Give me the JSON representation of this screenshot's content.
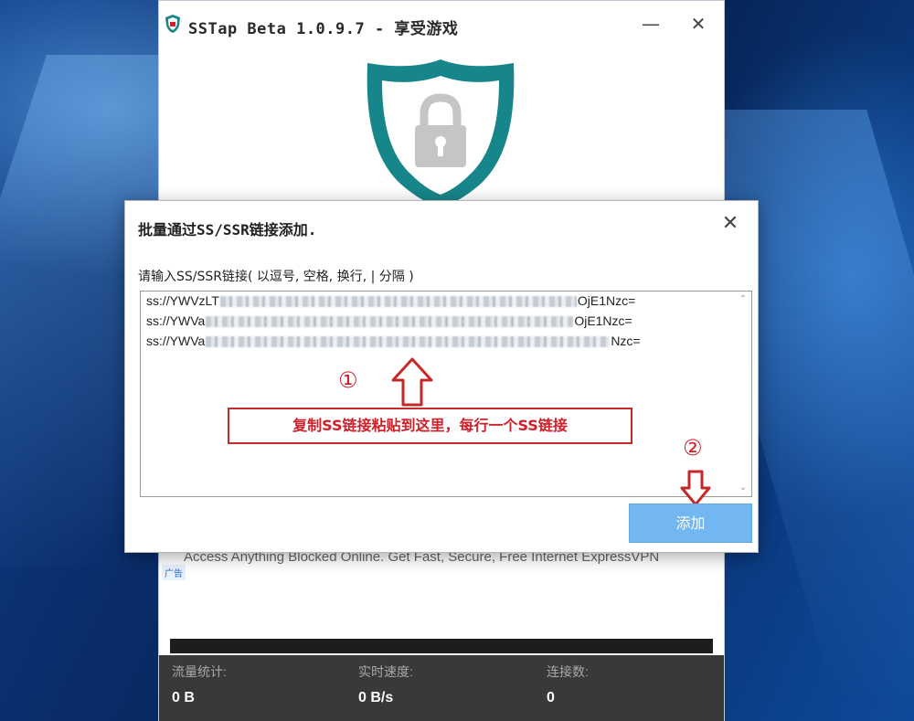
{
  "app": {
    "title": "SSTap Beta 1.0.9.7 - 享受游戏",
    "minimize_glyph": "—",
    "close_glyph": "✕"
  },
  "dialog": {
    "title": "批量通过SS/SSR链接添加.",
    "close_glyph": "✕",
    "prompt": "请输入SS/SSR链接( 以逗号, 空格, 换行, | 分隔 )",
    "lines": [
      {
        "prefix": "ss://YWVzLT",
        "suffix": "OjE1Nzc="
      },
      {
        "prefix": "ss://YWVa",
        "suffix": "OjE1Nzc="
      },
      {
        "prefix": "ss://YWVa",
        "suffix": "Nzc="
      }
    ],
    "add_button_label": "添加",
    "scroll_up_glyph": "⌃",
    "scroll_down_glyph": "⌄"
  },
  "annotations": {
    "marker_1": "①",
    "marker_2": "②",
    "instruction": "复制SS链接粘贴到这里，每行一个SS链接",
    "accent_color": "#d0202a"
  },
  "ad": {
    "text": "Access Anything Blocked Online. Get Fast, Secure, Free Internet ExpressVPN",
    "badge": "广告"
  },
  "stats": {
    "traffic_label": "流量统计:",
    "traffic_value": "0 B",
    "speed_label": "实时速度:",
    "speed_value": "0 B/s",
    "connections_label": "连接数:",
    "connections_value": "0"
  },
  "icons": {
    "app": "shield-icon",
    "logo": "shield-lock-logo",
    "arrow_up": "arrow-up-icon",
    "arrow_down": "arrow-down-icon"
  },
  "colors": {
    "shield_teal": "#17868a",
    "lock_gray": "#c5c5c5",
    "button_blue": "#72b7f2",
    "stats_bg": "#393939"
  }
}
